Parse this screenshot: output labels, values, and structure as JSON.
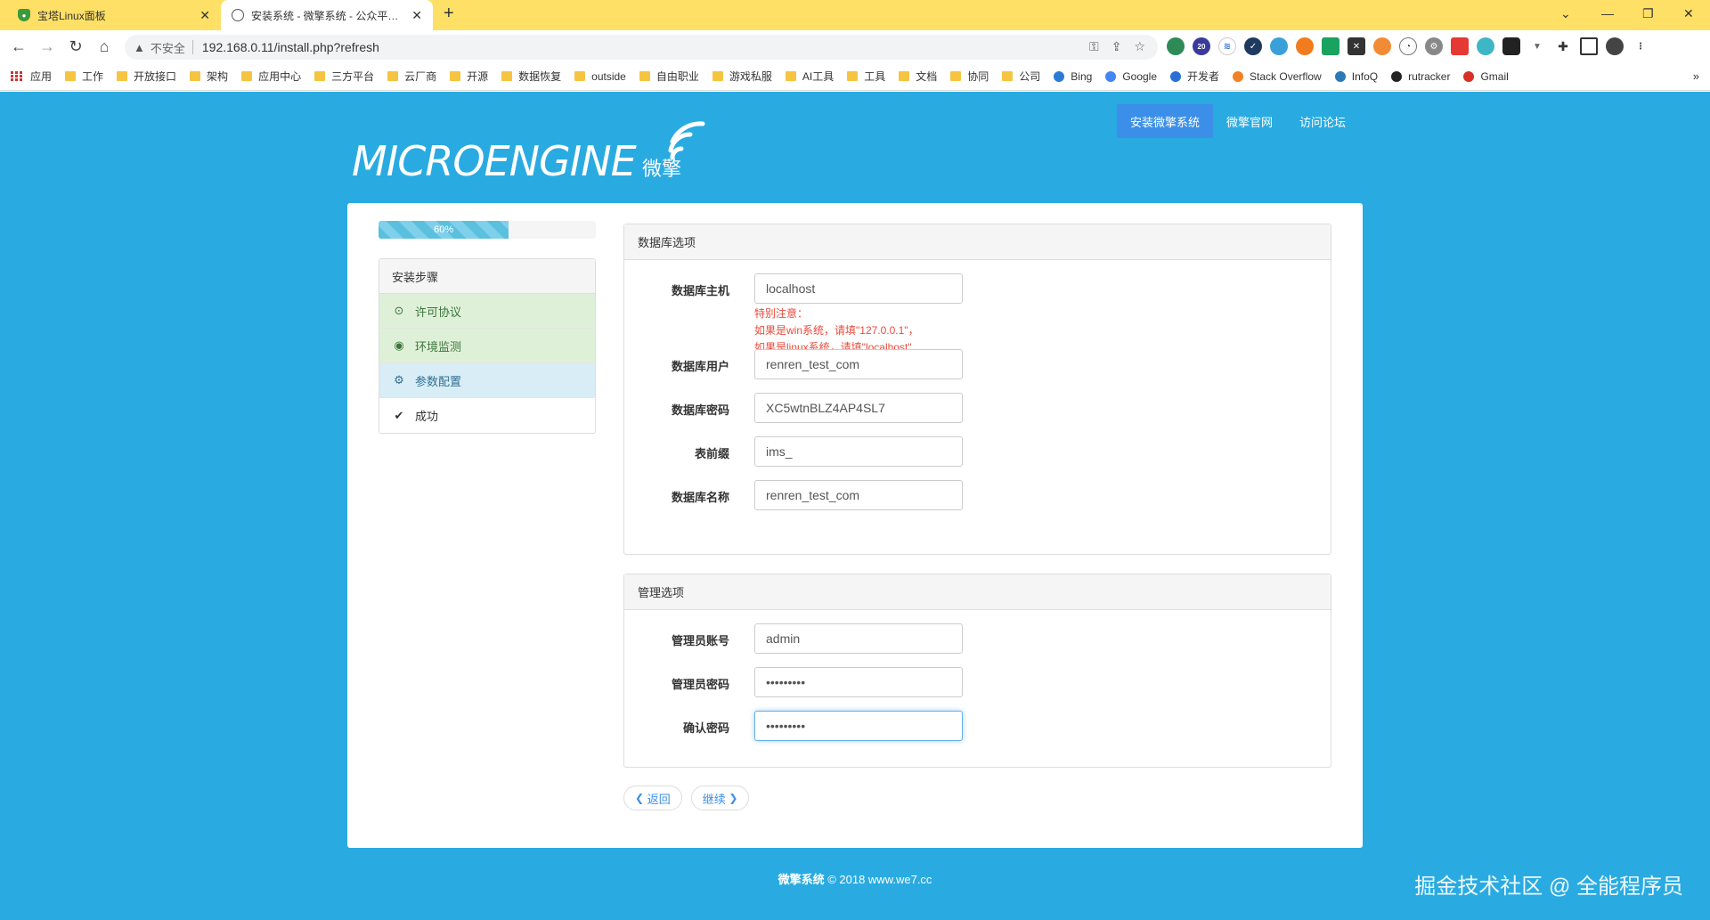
{
  "browser": {
    "tabs": [
      {
        "title": "宝塔Linux面板",
        "active": false
      },
      {
        "title": "安装系统 - 微擎系统 - 公众平台自助引擎",
        "active": true
      }
    ],
    "new_tab": "+",
    "window_controls": {
      "minimize": "⌄",
      "min2": "—",
      "restore": "❐",
      "close": "✕"
    },
    "address": {
      "security_label": "不安全",
      "url": "192.168.0.11/install.php?refresh"
    },
    "bookmarks": [
      {
        "label": "应用",
        "type": "apps"
      },
      {
        "label": "工作",
        "type": "folder"
      },
      {
        "label": "开放接口",
        "type": "folder"
      },
      {
        "label": "架构",
        "type": "folder"
      },
      {
        "label": "应用中心",
        "type": "folder"
      },
      {
        "label": "三方平台",
        "type": "folder"
      },
      {
        "label": "云厂商",
        "type": "folder"
      },
      {
        "label": "开源",
        "type": "folder"
      },
      {
        "label": "数据恢复",
        "type": "folder"
      },
      {
        "label": "outside",
        "type": "folder"
      },
      {
        "label": "自由职业",
        "type": "folder"
      },
      {
        "label": "游戏私服",
        "type": "folder"
      },
      {
        "label": "AI工具",
        "type": "folder"
      },
      {
        "label": "工具",
        "type": "folder"
      },
      {
        "label": "文档",
        "type": "folder"
      },
      {
        "label": "协同",
        "type": "folder"
      },
      {
        "label": "公司",
        "type": "folder"
      },
      {
        "label": "Bing",
        "type": "link"
      },
      {
        "label": "Google",
        "type": "link"
      },
      {
        "label": "开发者",
        "type": "link"
      },
      {
        "label": "Stack Overflow",
        "type": "link"
      },
      {
        "label": "InfoQ",
        "type": "link"
      },
      {
        "label": "rutracker",
        "type": "link"
      },
      {
        "label": "Gmail",
        "type": "link"
      }
    ],
    "bookmarks_more": "»",
    "extension_badge": "20"
  },
  "site": {
    "logo_text": "MICROENGINE",
    "logo_cn": "微擎",
    "nav": [
      {
        "label": "安装微擎系统",
        "active": true
      },
      {
        "label": "微擎官网",
        "active": false
      },
      {
        "label": "访问论坛",
        "active": false
      }
    ]
  },
  "progress": {
    "value": 0.6,
    "label": "60%"
  },
  "steps": {
    "heading": "安装步骤",
    "items": [
      {
        "label": "许可协议",
        "state": "done",
        "icon": "circle-check-icon"
      },
      {
        "label": "环境监测",
        "state": "done",
        "icon": "eye-icon"
      },
      {
        "label": "参数配置",
        "state": "current",
        "icon": "gear-icon"
      },
      {
        "label": "成功",
        "state": "todo",
        "icon": "check-icon"
      }
    ]
  },
  "db_panel": {
    "heading": "数据库选项",
    "host_label": "数据库主机",
    "host_value": "localhost",
    "host_help_1": "特别注意：",
    "host_help_2": "如果是win系统，请填\"127.0.0.1\"，",
    "host_help_3": "如果是linux系统，请填\"localhost\"",
    "user_label": "数据库用户",
    "user_value": "renren_test_com",
    "password_label": "数据库密码",
    "password_value": "XC5wtnBLZ4AP4SL7",
    "prefix_label": "表前缀",
    "prefix_value": "ims_",
    "name_label": "数据库名称",
    "name_value": "renren_test_com"
  },
  "admin_panel": {
    "heading": "管理选项",
    "account_label": "管理员账号",
    "account_value": "admin",
    "password_label": "管理员密码",
    "password_masked": "•••••••••",
    "confirm_label": "确认密码",
    "confirm_masked": "•••••••••"
  },
  "buttons": {
    "back": "返回",
    "next": "继续"
  },
  "footer": {
    "brand": "微擎系统",
    "copyright": " © 2018 www.we7.cc"
  },
  "watermark": "掘金技术社区 @ 全能程序员"
}
